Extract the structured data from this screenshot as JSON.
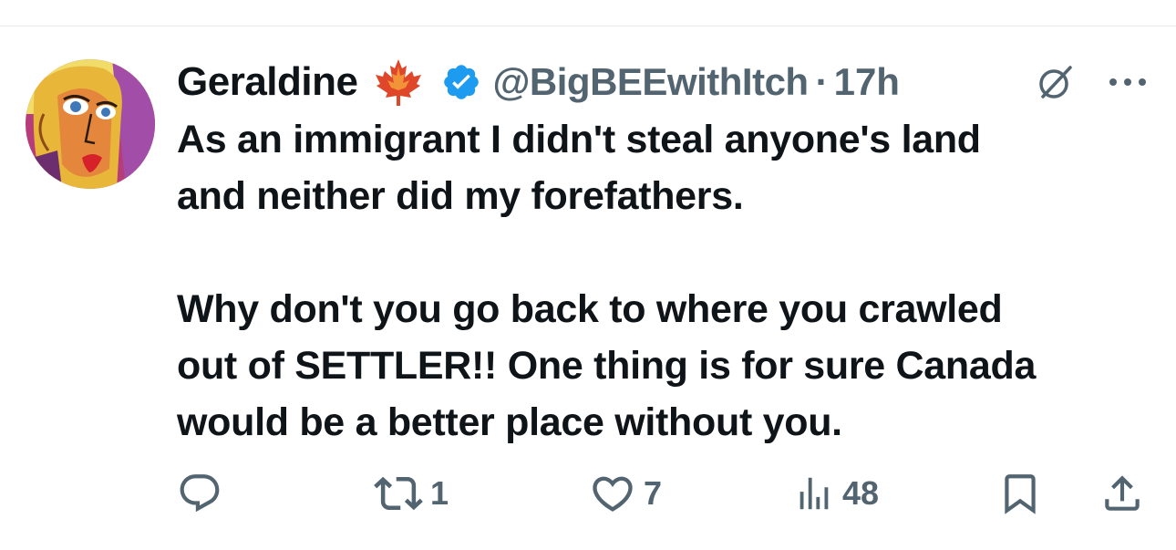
{
  "author": {
    "display_name": "Geraldine",
    "flag_emoji": "maple-leaf",
    "verified": true,
    "verified_color": "#1d9bf0",
    "handle": "@BigBEEwithItch",
    "separator": "·",
    "time_ago": "17h"
  },
  "tweet": {
    "paragraph1": "As an immigrant I didn't steal anyone's land\nand neither did my forefathers.",
    "paragraph2": "Why don't you go back to where you crawled\nout of SETTLER!! One thing is for sure Canada\nwould be a better place without you."
  },
  "actions": {
    "reply_count": "",
    "retweet_count": "1",
    "like_count": "7",
    "views_count": "48"
  },
  "colors": {
    "text_primary": "#0f1419",
    "text_secondary": "#536471",
    "divider": "#e6e9ec"
  },
  "icons": [
    "reply-icon",
    "retweet-icon",
    "like-icon",
    "views-icon",
    "bookmark-icon",
    "share-icon",
    "grok-icon",
    "more-icon",
    "verified-badge-icon",
    "maple-leaf-icon"
  ]
}
